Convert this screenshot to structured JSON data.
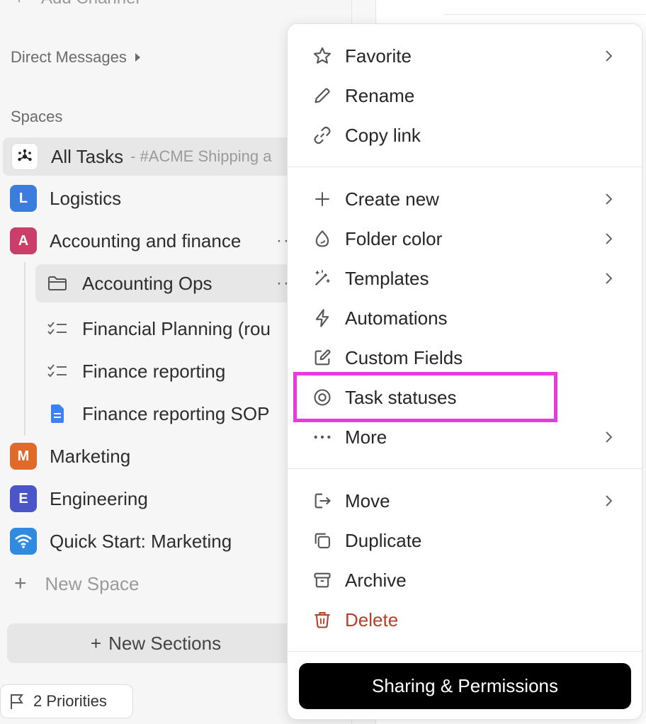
{
  "sidebar": {
    "add_channel": "Add Channel",
    "direct_messages": "Direct Messages",
    "spaces_label": "Spaces",
    "all_tasks": {
      "label": "All Tasks",
      "sub": "- #ACME Shipping a"
    },
    "spaces": [
      {
        "letter": "L",
        "label": "Logistics",
        "color": "#3b7ddd"
      },
      {
        "letter": "A",
        "label": "Accounting and finance",
        "color": "#c93f6a"
      },
      {
        "letter": "M",
        "label": "Marketing",
        "color": "#e06a2a"
      },
      {
        "letter": "E",
        "label": "Engineering",
        "color": "#4a55c7"
      }
    ],
    "children": [
      {
        "label": "Accounting Ops",
        "icon": "folder-icon"
      },
      {
        "label": "Financial Planning (rou",
        "icon": "checklist-icon"
      },
      {
        "label": "Finance reporting",
        "icon": "checklist-icon"
      },
      {
        "label": "Finance reporting SOP",
        "icon": "doc-icon"
      }
    ],
    "quick_start": {
      "label": "Quick Start: Marketing",
      "icon": "wifi-icon",
      "color": "#2f8ae0"
    },
    "new_space": "New Space",
    "new_sections": "New Sections",
    "priorities": "2 Priorities"
  },
  "menu": {
    "group1": [
      {
        "label": "Favorite",
        "icon": "star-icon",
        "submenu": true
      },
      {
        "label": "Rename",
        "icon": "pencil-icon",
        "submenu": false
      },
      {
        "label": "Copy link",
        "icon": "link-icon",
        "submenu": false
      }
    ],
    "group2": [
      {
        "label": "Create new",
        "icon": "plus-icon",
        "submenu": true
      },
      {
        "label": "Folder color",
        "icon": "drop-icon",
        "submenu": true
      },
      {
        "label": "Templates",
        "icon": "wand-icon",
        "submenu": true
      },
      {
        "label": "Automations",
        "icon": "bolt-icon",
        "submenu": false
      },
      {
        "label": "Custom Fields",
        "icon": "edit-box-icon",
        "submenu": false
      },
      {
        "label": "Task statuses",
        "icon": "status-icon",
        "submenu": false
      },
      {
        "label": "More",
        "icon": "more-icon",
        "submenu": true
      }
    ],
    "group3": [
      {
        "label": "Move",
        "icon": "move-icon",
        "submenu": true
      },
      {
        "label": "Duplicate",
        "icon": "duplicate-icon",
        "submenu": false
      },
      {
        "label": "Archive",
        "icon": "archive-icon",
        "submenu": false
      },
      {
        "label": "Delete",
        "icon": "trash-icon",
        "submenu": false,
        "color": "#b3402c"
      }
    ],
    "share_button": "Sharing & Permissions",
    "highlight_color": "#e93ae0"
  }
}
